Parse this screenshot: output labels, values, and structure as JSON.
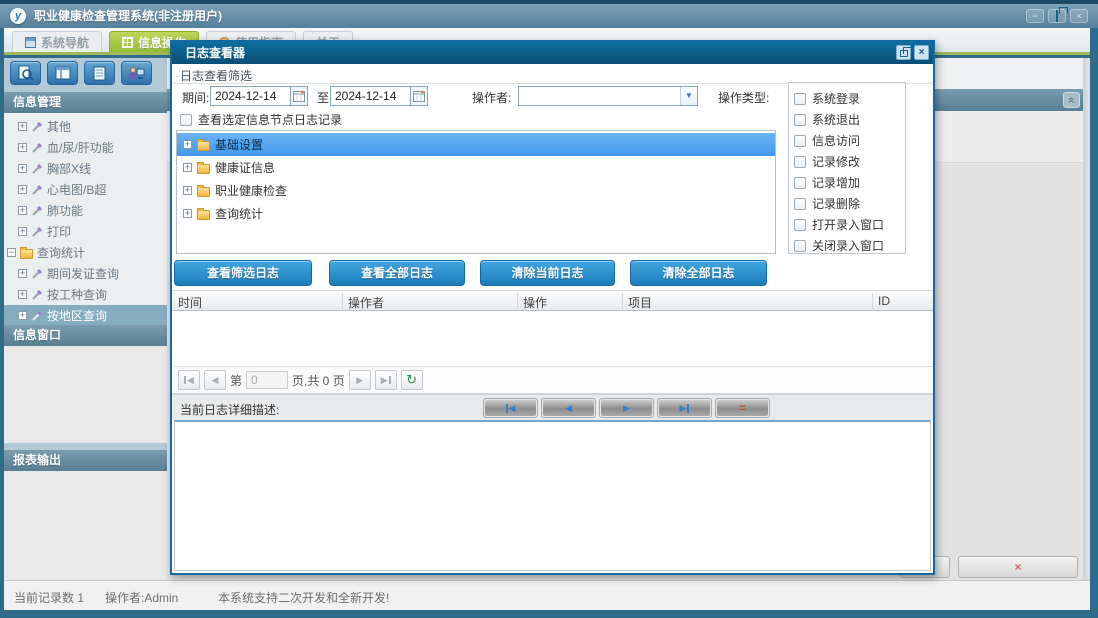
{
  "app": {
    "title": "职业健康检查管理系统(非注册用户)",
    "logo_letter": "y"
  },
  "icons": {
    "minimize": "−",
    "close": "×",
    "dropdown": "▼",
    "arrow_left": "◀",
    "arrow_right": "▶",
    "refresh": "↻",
    "equals": "=",
    "collapse_up": "«",
    "plus": "+",
    "minus": "−",
    "red_close": "×"
  },
  "tabs": [
    {
      "label": "系统导航",
      "active": false
    },
    {
      "label": "信息操作",
      "active": true
    },
    {
      "label": "使用指南",
      "active": false
    },
    {
      "label": "关于",
      "active": false
    }
  ],
  "sidebar": {
    "headers": {
      "info_manage": "信息管理",
      "info_window": "信息窗口",
      "report_output": "报表输出"
    },
    "tree": [
      {
        "label": "其他"
      },
      {
        "label": "血/尿/肝功能"
      },
      {
        "label": "胸部X线"
      },
      {
        "label": "心电图/B超"
      },
      {
        "label": "肺功能"
      },
      {
        "label": "打印"
      },
      {
        "label": "查询统计"
      },
      {
        "label": "期间发证查询"
      },
      {
        "label": "按工种查询"
      },
      {
        "label": "按地区查询",
        "selected": true
      }
    ]
  },
  "dialog": {
    "title": "日志查看器",
    "filter_group_label": "日志查看筛选",
    "period_label": "期间:",
    "date_from": "2024-12-14",
    "to_label": "至",
    "date_to": "2024-12-14",
    "operator_label": "操作者:",
    "operator_value": "",
    "op_type_label": "操作类型:",
    "op_types": [
      "系统登录",
      "系统退出",
      "信息访问",
      "记录修改",
      "记录增加",
      "记录删除",
      "打开录入窗口",
      "关闭录入窗口"
    ],
    "node_filter_label": "查看选定信息节点日志记录",
    "tree": [
      {
        "label": "基础设置",
        "selected": true
      },
      {
        "label": "健康证信息"
      },
      {
        "label": "职业健康检查"
      },
      {
        "label": "查询统计"
      }
    ],
    "buttons": [
      "查看筛选日志",
      "查看全部日志",
      "清除当前日志",
      "清除全部日志"
    ],
    "table_headers": [
      "时间",
      "操作者",
      "操作",
      "项目",
      "ID"
    ],
    "pagination": {
      "page_prefix": "第",
      "page_value": "0",
      "page_suffix": "页,共 0 页"
    },
    "detail_label": "当前日志详细描述:"
  },
  "statusbar": {
    "record_count": "当前记录数 1",
    "operator": "操作者:Admin",
    "message": "本系统支持二次开发和全新开发!"
  }
}
